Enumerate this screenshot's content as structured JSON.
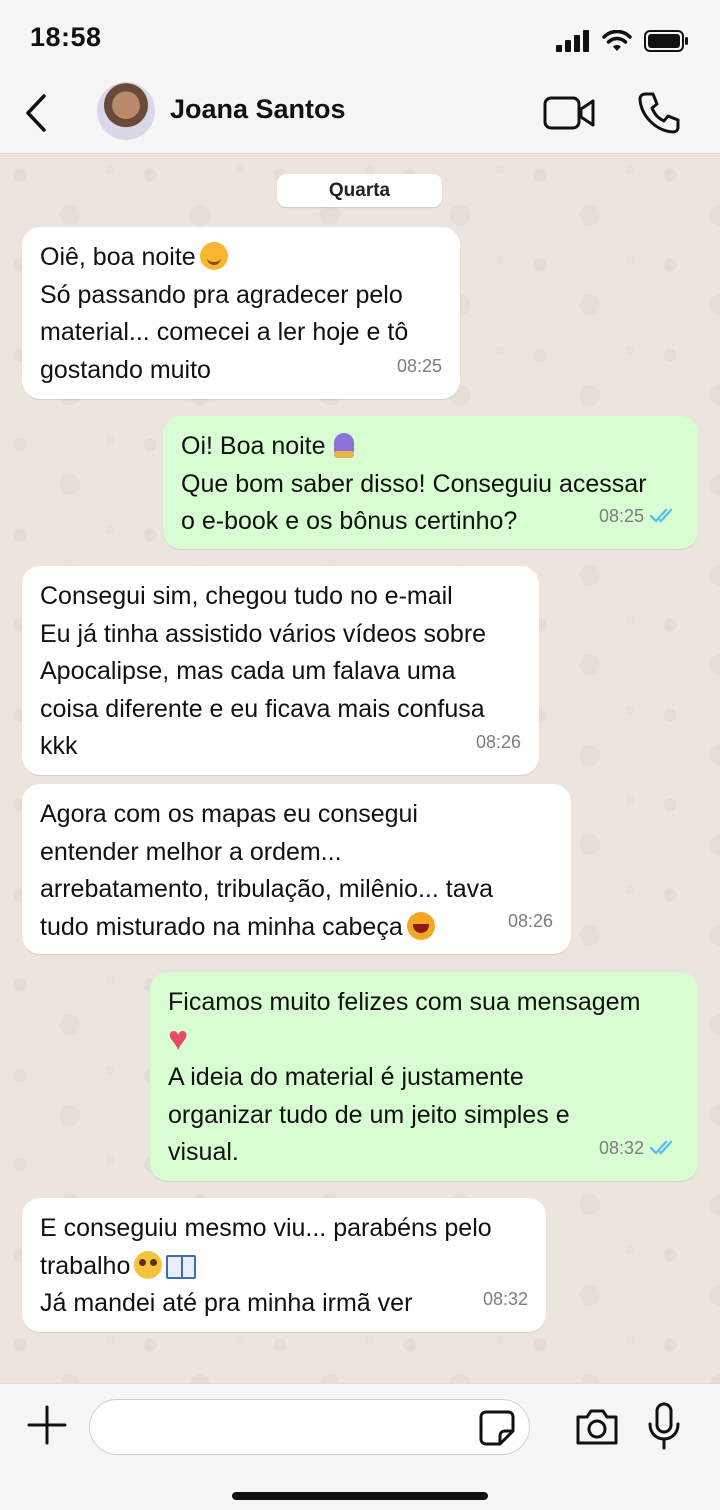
{
  "status": {
    "time": "18:58"
  },
  "header": {
    "contact_name": "Joana Santos"
  },
  "chat": {
    "day_label": "Quarta",
    "messages": [
      {
        "direction": "in",
        "lines": [
          "Oiê, boa noite",
          "Só passando pra agradecer pelo",
          "material... comecei a ler hoje e tô",
          "gostando muito"
        ],
        "time": "08:25"
      },
      {
        "direction": "out",
        "lines": [
          "Oi! Boa noite",
          "Que bom saber disso! Conseguiu acessar",
          "o e-book e os bônus certinho?"
        ],
        "time": "08:25"
      },
      {
        "direction": "in",
        "lines": [
          "Consegui sim, chegou tudo no e-mail",
          "Eu já tinha assistido vários vídeos sobre",
          "Apocalipse, mas cada um falava uma",
          "coisa diferente e eu ficava mais confusa",
          "kkk"
        ],
        "time": "08:26"
      },
      {
        "direction": "in",
        "lines": [
          "Agora com os mapas eu consegui",
          "entender melhor a ordem...",
          "arrebatamento, tribulação, milênio... tava",
          "tudo misturado na minha cabeça"
        ],
        "time": "08:26"
      },
      {
        "direction": "out",
        "lines": [
          "Ficamos muito felizes com sua mensagem",
          "",
          "A ideia do material é justamente",
          "organizar tudo de um jeito simples e",
          "visual."
        ],
        "time": "08:32"
      },
      {
        "direction": "in",
        "lines": [
          "E conseguiu mesmo viu... parabéns pelo",
          "trabalho",
          "Já mandei até pra minha irmã ver"
        ],
        "time": "08:32"
      }
    ]
  },
  "input": {
    "value": "",
    "placeholder": ""
  },
  "icons": {
    "back": "chevron-left-icon",
    "video": "video-call-icon",
    "call": "phone-icon",
    "plus": "plus-icon",
    "sticker": "sticker-icon",
    "camera": "camera-icon",
    "mic": "microphone-icon",
    "read_receipt": "double-check-icon"
  },
  "colors": {
    "incoming_bubble": "#ffffff",
    "outgoing_bubble": "#d9fdd3",
    "read_receipt": "#53bdeb",
    "background": "#ece5dd"
  }
}
